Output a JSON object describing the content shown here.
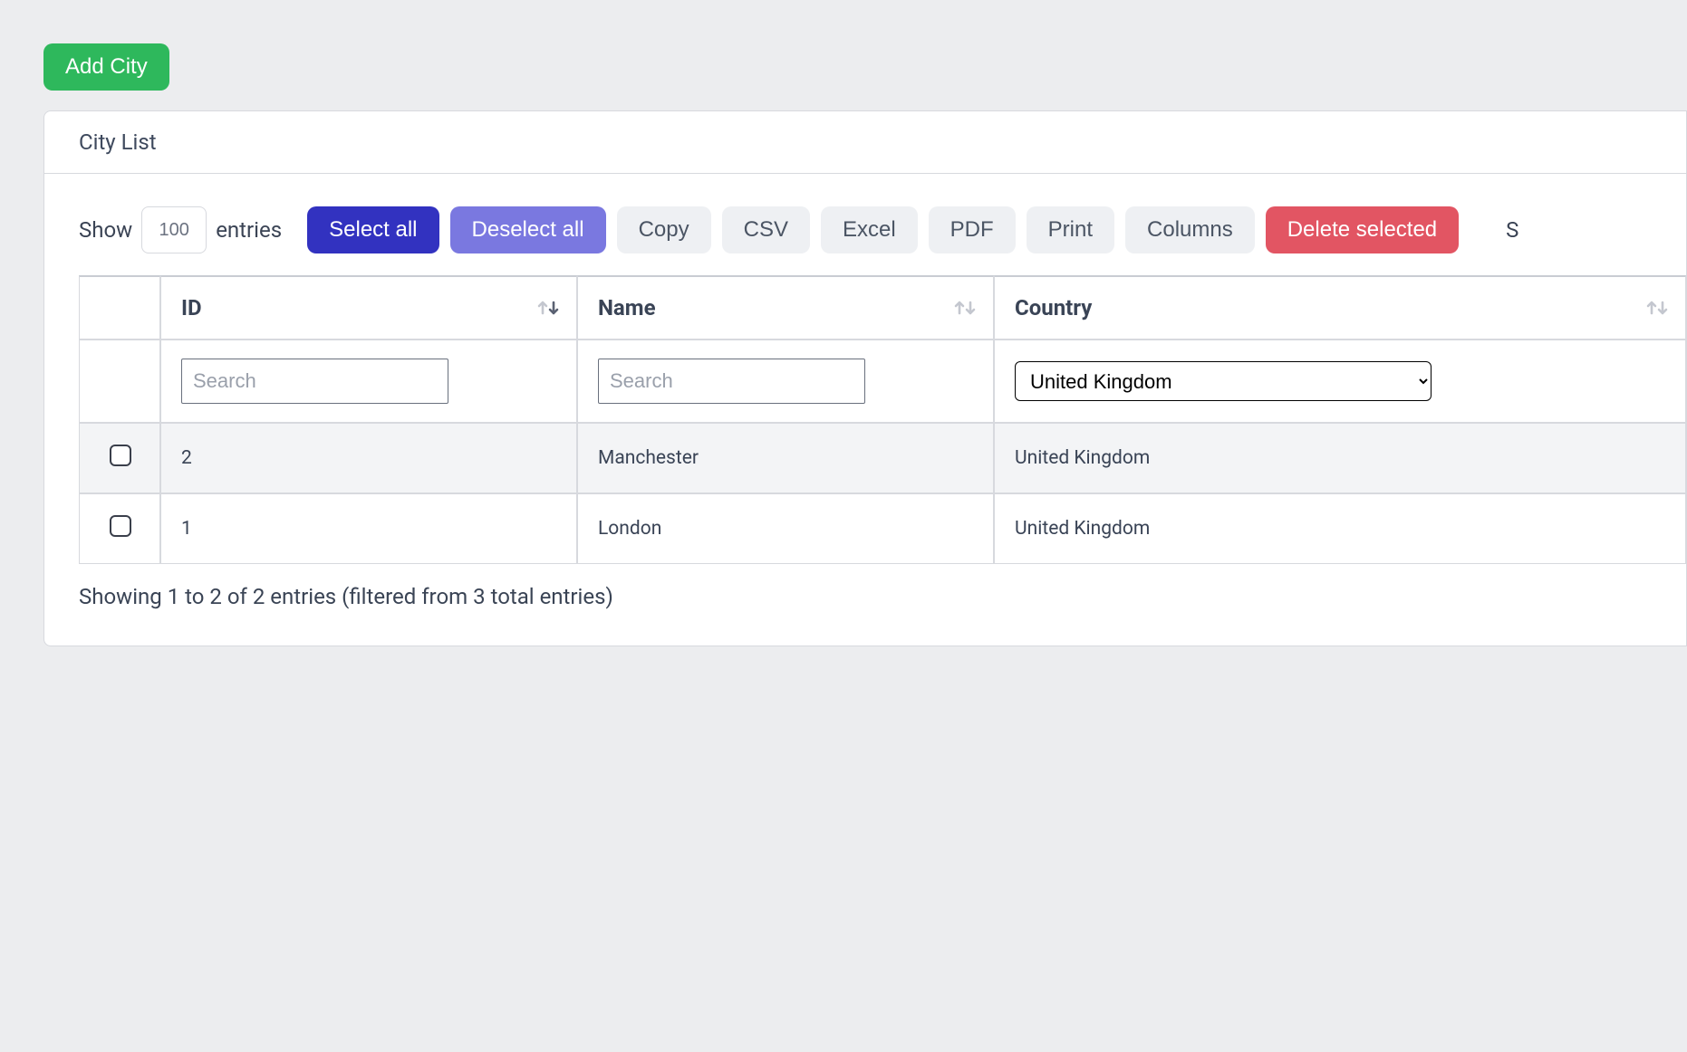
{
  "buttons": {
    "add_city": "Add City",
    "select_all": "Select all",
    "deselect_all": "Deselect all",
    "copy": "Copy",
    "csv": "CSV",
    "excel": "Excel",
    "pdf": "PDF",
    "print": "Print",
    "columns": "Columns",
    "delete_selected": "Delete selected"
  },
  "card": {
    "title": "City List"
  },
  "length_control": {
    "prefix": "Show",
    "value": "100",
    "suffix": "entries"
  },
  "search_label_cut": "S",
  "columns": {
    "id": "ID",
    "name": "Name",
    "country": "Country"
  },
  "filters": {
    "search_placeholder": "Search",
    "country_selected": "United Kingdom"
  },
  "rows": [
    {
      "id": "2",
      "name": "Manchester",
      "country": "United Kingdom"
    },
    {
      "id": "1",
      "name": "London",
      "country": "United Kingdom"
    }
  ],
  "info": "Showing 1 to 2 of 2 entries (filtered from 3 total entries)"
}
